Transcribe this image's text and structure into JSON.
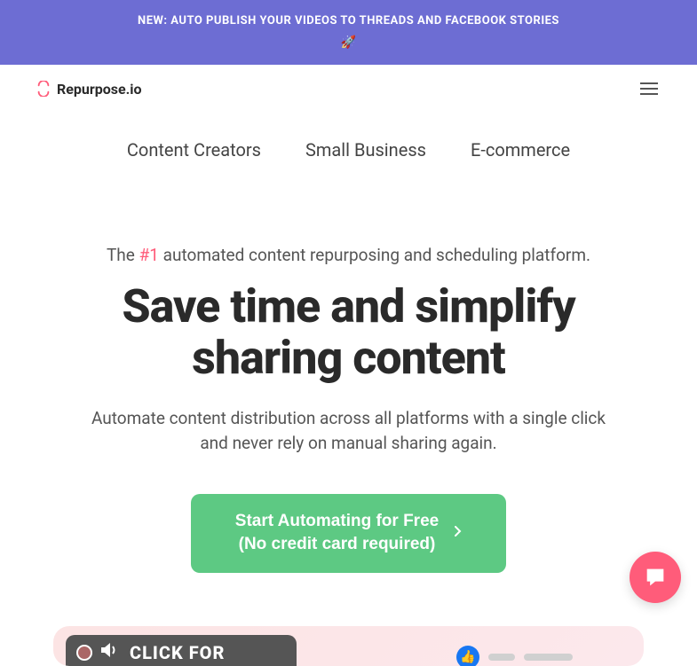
{
  "announcement": {
    "text": "NEW: AUTO PUBLISH YOUR VIDEOS TO THREADS AND FACEBOOK STORIES",
    "emoji": "🚀"
  },
  "brand": {
    "name": "Repurpose.io"
  },
  "nav": {
    "tabs": [
      {
        "label": "Content Creators"
      },
      {
        "label": "Small Business"
      },
      {
        "label": "E-commerce"
      }
    ]
  },
  "hero": {
    "tagline_prefix": "The ",
    "tagline_highlight": "#1",
    "tagline_suffix": " automated content repurposing and scheduling platform.",
    "headline": "Save time and simplify sharing content",
    "subheadline": "Automate content distribution across all platforms with a single click and never rely on manual sharing again.",
    "cta_line1": "Start Automating for Free",
    "cta_line2": "(No credit card required)"
  },
  "preview": {
    "click_text": "CLICK FOR"
  }
}
